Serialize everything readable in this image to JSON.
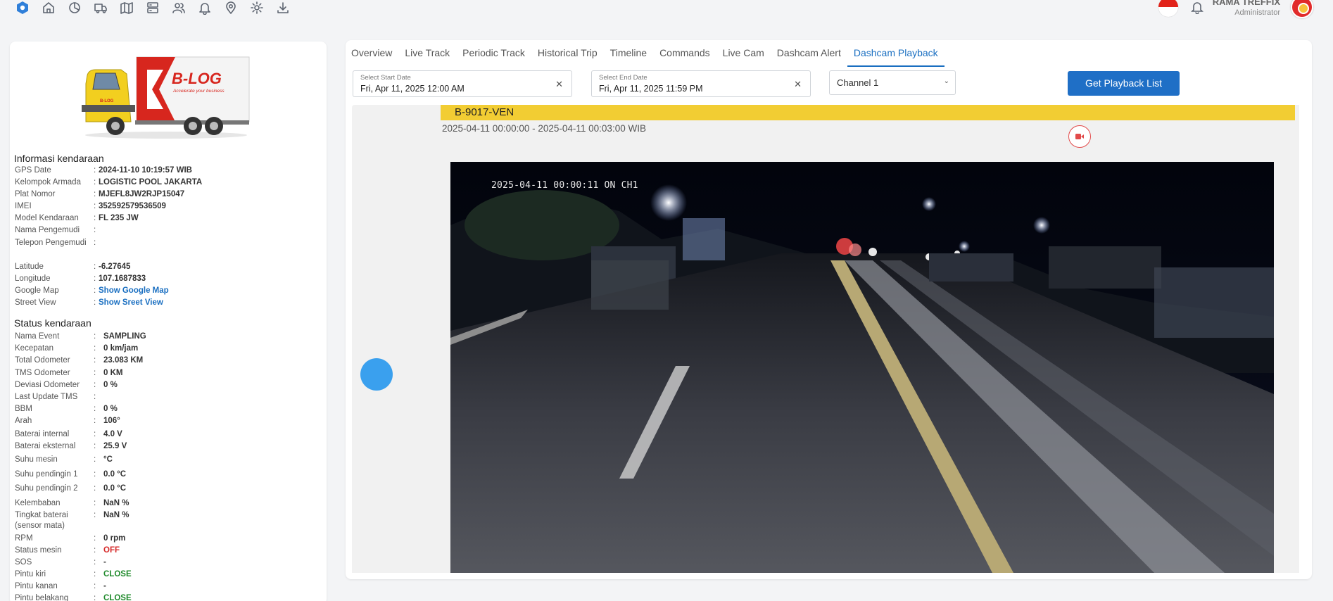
{
  "user": {
    "name": "RAMA TREFFIX",
    "role": "Administrator"
  },
  "top_nav": [
    "app-logo-icon",
    "home-icon",
    "dashboard-icon",
    "truck-icon",
    "map-icon",
    "server-icon",
    "users-icon",
    "bell-icon",
    "location-pin-icon",
    "gear-icon",
    "download-icon"
  ],
  "vehicle_info": {
    "title": "Informasi kendaraan",
    "rows": [
      {
        "label": "GPS Date",
        "value": "2024-11-10 10:19:57 WIB"
      },
      {
        "label": "Kelompok Armada",
        "value": "LOGISTIC POOL JAKARTA"
      },
      {
        "label": "Plat Nomor",
        "value": "MJEFL8JW2RJP15047"
      },
      {
        "label": "IMEI",
        "value": "352592579536509"
      },
      {
        "label": "Model Kendaraan",
        "value": "FL 235 JW"
      },
      {
        "label": "Nama Pengemudi",
        "value": ""
      },
      {
        "label": "Telepon Pengemudi",
        "value": ""
      },
      {
        "label": "Latitude",
        "value": "-6.27645"
      },
      {
        "label": "Longitude",
        "value": "107.1687833"
      },
      {
        "label": "Google Map",
        "value": "Show Google Map"
      },
      {
        "label": "Street View",
        "value": "Show Sreet View"
      }
    ]
  },
  "vehicle_status": {
    "title": "Status kendaraan",
    "rows": [
      {
        "label": "Nama Event",
        "value": "SAMPLING"
      },
      {
        "label": "Kecepatan",
        "value": "0 km/jam"
      },
      {
        "label": "Total Odometer",
        "value": "23.083 KM"
      },
      {
        "label": "TMS Odometer",
        "value": "0 KM"
      },
      {
        "label": "Deviasi Odometer",
        "value": "0 %"
      },
      {
        "label": "Last Update TMS",
        "value": ""
      },
      {
        "label": "BBM",
        "value": "0 %"
      },
      {
        "label": "Arah",
        "value": "106°"
      },
      {
        "label": "Baterai internal",
        "value": "4.0 V"
      },
      {
        "label": "Baterai eksternal",
        "value": "25.9 V"
      },
      {
        "label": "Suhu mesin",
        "value": "°C"
      },
      {
        "label": "Suhu pendingin 1",
        "value": "0.0 °C"
      },
      {
        "label": "Suhu pendingin 2",
        "value": "0.0 °C"
      },
      {
        "label": "Kelembaban",
        "value": "NaN %"
      },
      {
        "label": "Tingkat baterai (sensor mata)",
        "value": "NaN %"
      },
      {
        "label": "RPM",
        "value": "0 rpm"
      },
      {
        "label": "Status mesin",
        "value": "OFF"
      },
      {
        "label": "SOS",
        "value": "-"
      },
      {
        "label": "Pintu kiri",
        "value": "CLOSE"
      },
      {
        "label": "Pintu kanan",
        "value": "-"
      },
      {
        "label": "Pintu belakang",
        "value": "CLOSE"
      }
    ]
  },
  "tabs": [
    "Overview",
    "Live Track",
    "Periodic Track",
    "Historical Trip",
    "Timeline",
    "Commands",
    "Live Cam",
    "Dashcam Alert",
    "Dashcam Playback"
  ],
  "active_tab": "Dashcam Playback",
  "filters": {
    "start_label": "Select Start Date",
    "start_value": "Fri, Apr 11, 2025 12:00 AM",
    "end_label": "Select End Date",
    "end_value": "Fri, Apr 11, 2025 11:59 PM",
    "clear_glyph": "✕",
    "channel": "Channel 1",
    "button": "Get Playback List"
  },
  "playback": {
    "vehicle": "B-9017-VEN",
    "time_range": "2025-04-11 00:00:00 - 2025-04-11 00:03:00 WIB",
    "osd": "2025-04-11 00:00:11 ON  CH1"
  },
  "logo_text": {
    "brand": "B-LOG",
    "tagline": "Accelerate your business",
    "truck_label": "B-LOG"
  },
  "colors": {
    "accent": "#1a6fc1",
    "vehicle_bar": "#f2cd33",
    "nav_dot": "#3aa0ee",
    "status_off": "#d62828",
    "status_close": "#1f8a2b"
  }
}
